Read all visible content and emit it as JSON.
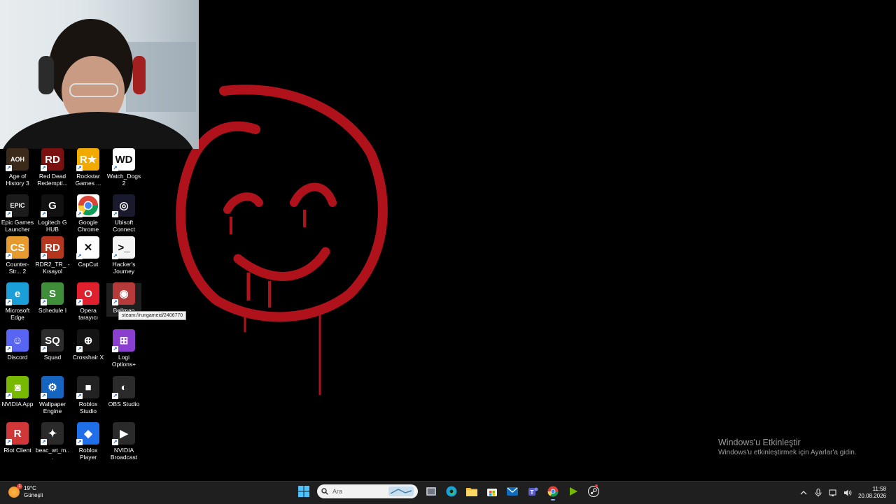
{
  "desktop": {
    "icons": [
      {
        "name": "age-of-history-3",
        "label": "Age of History 3",
        "glyph": "AOH",
        "bg": "#3b2a1a"
      },
      {
        "name": "red-dead-redemption",
        "label": "Red Dead Redempti...",
        "glyph": "RD",
        "bg": "#7a1010"
      },
      {
        "name": "rockstar-games",
        "label": "Rockstar Games ...",
        "glyph": "R★",
        "bg": "#f2a900"
      },
      {
        "name": "watch-dogs-2",
        "label": "Watch_Dogs 2",
        "glyph": "WD",
        "bg": "#ffffff"
      },
      {
        "name": "epic-games-launcher",
        "label": "Epic Games Launcher",
        "glyph": "EPIC",
        "bg": "#1b1b1b"
      },
      {
        "name": "logitech-g-hub",
        "label": "Logitech G HUB",
        "glyph": "G",
        "bg": "#111111"
      },
      {
        "name": "google-chrome",
        "label": "Google Chrome",
        "glyph": "",
        "bg": "#ffffff"
      },
      {
        "name": "ubisoft-connect",
        "label": "Ubisoft Connect",
        "glyph": "◎",
        "bg": "#1a1a2e"
      },
      {
        "name": "counter-strike-2",
        "label": "Counter-Str... 2",
        "glyph": "CS",
        "bg": "#e79a2d"
      },
      {
        "name": "rdr2-tr-kisayol",
        "label": "RDR2_TR_ - Kısayol",
        "glyph": "RD",
        "bg": "#b5361f"
      },
      {
        "name": "capcut",
        "label": "CapCut",
        "glyph": "✕",
        "bg": "#ffffff"
      },
      {
        "name": "hackers-journey",
        "label": "Hacker's Journey",
        "glyph": ">_",
        "bg": "#f4f4f4"
      },
      {
        "name": "microsoft-edge",
        "label": "Microsoft Edge",
        "glyph": "e",
        "bg": "#1a9fd8"
      },
      {
        "name": "schedule-i",
        "label": "Schedule I",
        "glyph": "S",
        "bg": "#3f8f3a"
      },
      {
        "name": "opera-tarayici",
        "label": "Opera tarayıcı",
        "glyph": "O",
        "bg": "#e0202c"
      },
      {
        "name": "bellman",
        "label": "Bellman",
        "glyph": "◉",
        "bg": "#b63a3a"
      },
      {
        "name": "discord",
        "label": "Discord",
        "glyph": "☺",
        "bg": "#5865f2"
      },
      {
        "name": "squad",
        "label": "Squad",
        "glyph": "SQ",
        "bg": "#2c2c2c"
      },
      {
        "name": "crosshair-x",
        "label": "Crosshair X",
        "glyph": "⊕",
        "bg": "#141414"
      },
      {
        "name": "logi-options",
        "label": "Logi Options+",
        "glyph": "⊞",
        "bg": "#8a3fd1"
      },
      {
        "name": "nvidia-app",
        "label": "NVIDIA App",
        "glyph": "◙",
        "bg": "#76b900"
      },
      {
        "name": "wallpaper-engine",
        "label": "Wallpaper Engine",
        "glyph": "⚙",
        "bg": "#1565c0"
      },
      {
        "name": "roblox-studio",
        "label": "Roblox Studio",
        "glyph": "■",
        "bg": "#222222"
      },
      {
        "name": "obs-studio",
        "label": "OBS Studio",
        "glyph": "◐",
        "bg": "#2b2b2b"
      },
      {
        "name": "riot-client",
        "label": "Riot Client",
        "glyph": "R",
        "bg": "#d13639"
      },
      {
        "name": "beac-wt-m",
        "label": "beac_wt_m...",
        "glyph": "✦",
        "bg": "#2a2a2a"
      },
      {
        "name": "roblox-player",
        "label": "Roblox Player",
        "glyph": "◆",
        "bg": "#1f6feb"
      },
      {
        "name": "nvidia-broadcast",
        "label": "NVIDIA Broadcast",
        "glyph": "▶",
        "bg": "#2a2a2a"
      }
    ],
    "tooltip": "steam://rungameid/2406770",
    "activation": {
      "title": "Windows'u Etkinleştir",
      "subtitle": "Windows'u etkinleştirmek için Ayarlar'a gidin."
    }
  },
  "taskbar": {
    "weather": {
      "temp": "19°C",
      "desc": "Güneşli",
      "badge": "1"
    },
    "search_placeholder": "Ara",
    "apps": [
      {
        "name": "start-icon"
      },
      {
        "name": "task-view-icon"
      },
      {
        "name": "edge-icon"
      },
      {
        "name": "file-explorer-icon"
      },
      {
        "name": "store-icon"
      },
      {
        "name": "mail-icon"
      },
      {
        "name": "teams-icon"
      },
      {
        "name": "chrome-icon"
      },
      {
        "name": "nvidia-icon"
      },
      {
        "name": "steam-icon"
      }
    ],
    "clock": {
      "time": "11:58",
      "date": "20.08.2026"
    }
  }
}
